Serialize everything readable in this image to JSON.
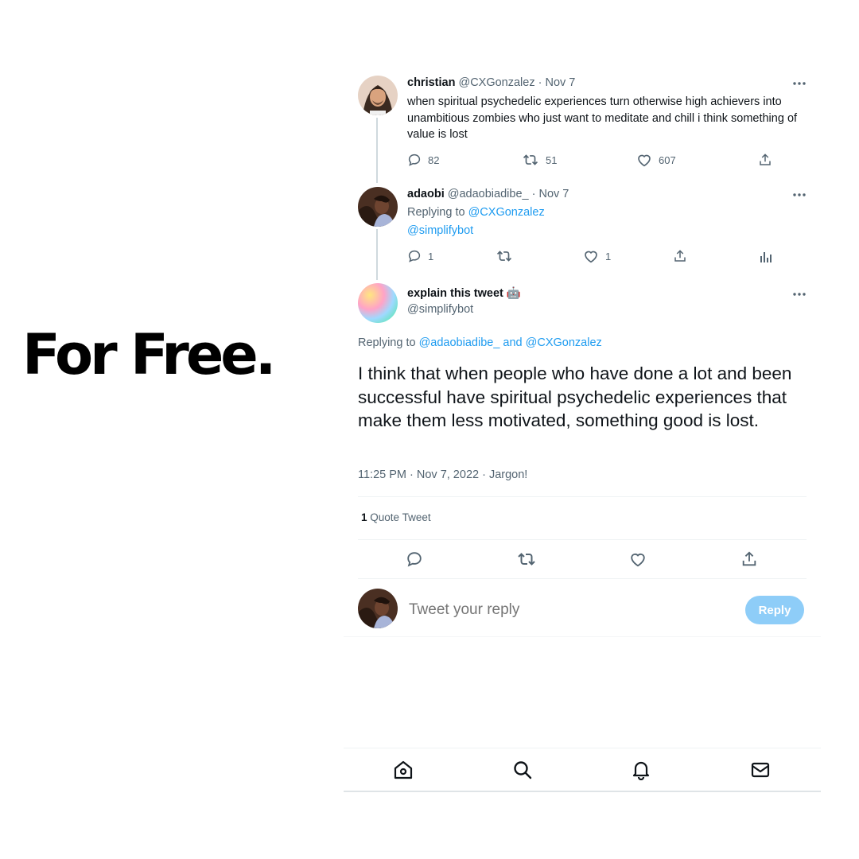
{
  "headline": "For Free.",
  "tweets": [
    {
      "name": "christian",
      "handle": "@CXGonzalez",
      "date": "· Nov 7",
      "text": "when spiritual psychedelic experiences turn otherwise high achievers into unambitious zombies who just want to meditate and chill i think something of value is lost",
      "replies": "82",
      "retweets": "51",
      "likes": "607"
    },
    {
      "name": "adaobi",
      "handle": "@adaobiadibe_",
      "date": "· Nov 7",
      "replying_prefix": "Replying to",
      "replying_to": "@CXGonzalez",
      "text": "@simplifybot",
      "replies": "1",
      "likes": "1"
    }
  ],
  "main_tweet": {
    "name": "explain this tweet",
    "emoji": "🤖",
    "handle": "@simplifybot",
    "replying_prefix": "Replying to",
    "replying_to_1": "@adaobiadibe_",
    "replying_and": "and",
    "replying_to_2": "@CXGonzalez",
    "text": "I think that when people who have done a lot and been successful have spiritual psychedelic experiences that make them less motivated, something good is lost.",
    "meta": "11:25 PM · Nov 7, 2022 · Jargon!",
    "quote_count": "1",
    "quote_label": "Quote Tweet"
  },
  "composer": {
    "placeholder": "Tweet your reply",
    "button": "Reply"
  },
  "icons": [
    "home-icon",
    "search-icon",
    "notifications-icon",
    "messages-icon"
  ],
  "colors": {
    "link": "#1d9bf0",
    "muted": "#536471",
    "reply_button": "#8ecdf8"
  }
}
